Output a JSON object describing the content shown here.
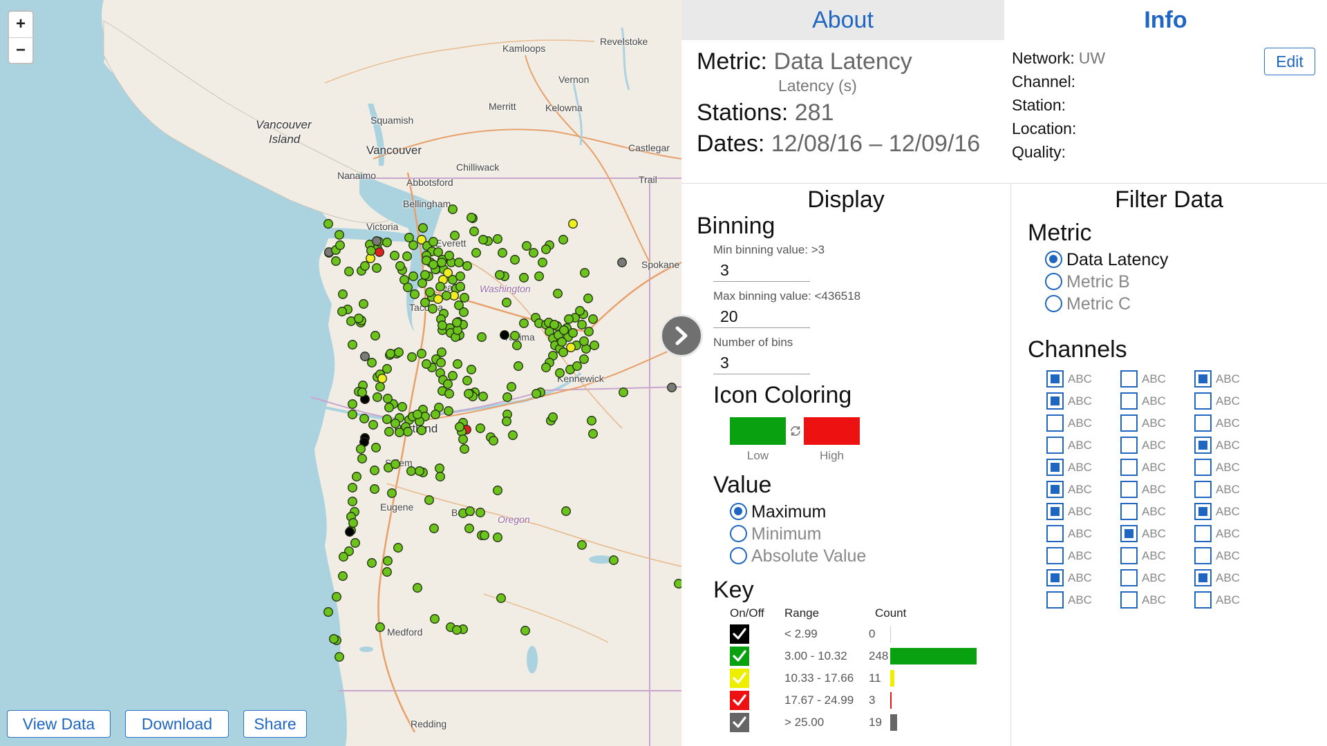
{
  "map": {
    "zoom_in": "+",
    "zoom_out": "−",
    "places": [
      {
        "name": "Kamloops"
      },
      {
        "name": "Revelstoke"
      },
      {
        "name": "Vernon"
      },
      {
        "name": "Merritt"
      },
      {
        "name": "Kelowna"
      },
      {
        "name": "Squamish"
      },
      {
        "name": "Vancouver Island"
      },
      {
        "name": "Vancouver"
      },
      {
        "name": "Chilliwack"
      },
      {
        "name": "Nanaimo"
      },
      {
        "name": "Castlegar"
      },
      {
        "name": "Abbotsford"
      },
      {
        "name": "Trail"
      },
      {
        "name": "Bellingham"
      },
      {
        "name": "Victoria"
      },
      {
        "name": "Everett"
      },
      {
        "name": "Spokane"
      },
      {
        "name": "Seattle"
      },
      {
        "name": "Washington"
      },
      {
        "name": "Tacoma"
      },
      {
        "name": "Yakima"
      },
      {
        "name": "Kennewick"
      },
      {
        "name": "Portland"
      },
      {
        "name": "Salem"
      },
      {
        "name": "Eugene"
      },
      {
        "name": "Bend"
      },
      {
        "name": "Oregon"
      },
      {
        "name": "Medford"
      },
      {
        "name": "Redding"
      }
    ],
    "buttons": {
      "view_data": "View Data",
      "download": "Download",
      "share": "Share"
    }
  },
  "tabs": {
    "about": "About",
    "info": "Info"
  },
  "about": {
    "metric_label": "Metric:",
    "metric_value": "Data Latency",
    "metric_unit": "Latency (s)",
    "stations_label": "Stations:",
    "stations_value": "281",
    "dates_label": "Dates:",
    "dates_value": "12/08/16 – 12/09/16"
  },
  "info": {
    "network_label": "Network:",
    "network_value": "UW",
    "channel_label": "Channel:",
    "station_label": "Station:",
    "location_label": "Location:",
    "quality_label": "Quality:",
    "edit_button": "Edit"
  },
  "display": {
    "title": "Display",
    "binning_title": "Binning",
    "min_label": "Min binning value: >3",
    "min_value": "3",
    "max_label": "Max binning value: <436518",
    "max_value": "20",
    "bins_label": "Number of bins",
    "bins_value": "3",
    "icon_coloring_title": "Icon Coloring",
    "low_label": "Low",
    "high_label": "High",
    "low_color": "#0aa110",
    "high_color": "#ee1111",
    "value_title": "Value",
    "value_options": [
      {
        "label": "Maximum",
        "selected": true
      },
      {
        "label": "Minimum",
        "selected": false
      },
      {
        "label": "Absolute Value",
        "selected": false
      }
    ],
    "key_title": "Key",
    "key_headers": {
      "onoff": "On/Off",
      "range": "Range",
      "count": "Count"
    },
    "key_rows": [
      {
        "range": "< 2.99",
        "count": "0",
        "color": "#000000",
        "fraction": 0
      },
      {
        "range": "3.00 - 10.32",
        "count": "248",
        "color": "#0aa110",
        "fraction": 1.0
      },
      {
        "range": "10.33 - 17.66",
        "count": "11",
        "color": "#eeee00",
        "fraction": 0.044
      },
      {
        "range": "17.67 - 24.99",
        "count": "3",
        "color": "#ee1111",
        "fraction": 0.012
      },
      {
        "range": "> 25.00",
        "count": "19",
        "color": "#666666",
        "fraction": 0.077
      }
    ]
  },
  "filter": {
    "title": "Filter Data",
    "metric_title": "Metric",
    "metric_options": [
      {
        "label": "Data Latency",
        "selected": true
      },
      {
        "label": "Metric B",
        "selected": false
      },
      {
        "label": "Metric C",
        "selected": false
      }
    ],
    "channels_title": "Channels",
    "channel_label": "ABC",
    "channels": [
      [
        true,
        false,
        true
      ],
      [
        true,
        false,
        false
      ],
      [
        false,
        false,
        false
      ],
      [
        false,
        false,
        true
      ],
      [
        true,
        false,
        false
      ],
      [
        true,
        false,
        false
      ],
      [
        true,
        false,
        true
      ],
      [
        false,
        true,
        false
      ],
      [
        false,
        false,
        false
      ],
      [
        true,
        false,
        true
      ],
      [
        false,
        false,
        false
      ]
    ]
  },
  "colors": {
    "accent": "#1f66c2",
    "station_green": "#6cc31c",
    "station_yellow": "#eeee22",
    "station_red": "#e02020",
    "station_gray": "#7a7a7a",
    "station_black": "#000000"
  }
}
